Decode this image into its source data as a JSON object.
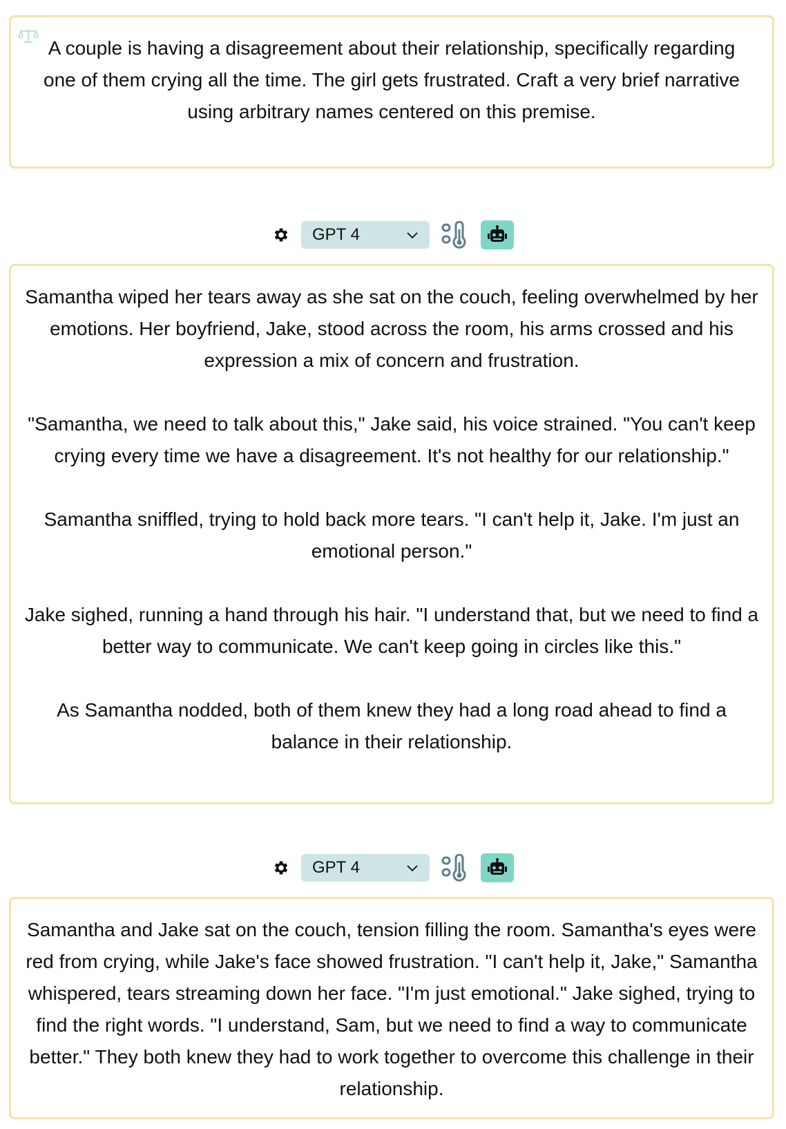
{
  "prompt": {
    "text": "A couple is having a disagreement about their relationship, specifically regarding one of them crying all the time. The girl gets frustrated. Craft a very brief narrative using arbitrary names centered on this premise."
  },
  "responses": [
    {
      "model_label": "GPT 4",
      "paragraphs": [
        "Samantha wiped her tears away as she sat on the couch, feeling overwhelmed by her emotions. Her boyfriend, Jake, stood across the room, his arms crossed and his expression a mix of concern and frustration.",
        "\"Samantha, we need to talk about this,\" Jake said, his voice strained. \"You can't keep crying every time we have a disagreement. It's not healthy for our relationship.\"",
        "Samantha sniffled, trying to hold back more tears. \"I can't help it, Jake. I'm just an emotional person.\"",
        "Jake sighed, running a hand through his hair. \"I understand that, but we need to find a better way to communicate. We can't keep going in circles like this.\"",
        "As Samantha nodded, both of them knew they had a long road ahead to find a balance in their relationship."
      ]
    },
    {
      "model_label": "GPT 4",
      "paragraphs": [
        "Samantha and Jake sat on the couch, tension filling the room. Samantha's eyes were red from crying, while Jake's face showed frustration. \"I can't help it, Jake,\" Samantha whispered, tears streaming down her face. \"I'm just emotional.\" Jake sighed, trying to find the right words. \"I understand, Sam, but we need to find a way to communicate better.\" They both knew they had to work together to overcome this challenge in their relationship."
      ]
    }
  ],
  "icons": {
    "prompt_corner": "scale-icon",
    "settings": "gear-icon",
    "temperature": "thermometer-icon",
    "assistant": "robot-icon",
    "dropdown": "chevron-down-icon"
  },
  "colors": {
    "card_border": "#f2e4ab",
    "select_bg": "#cfe5e5",
    "robot_bg": "#7fd6c5"
  }
}
